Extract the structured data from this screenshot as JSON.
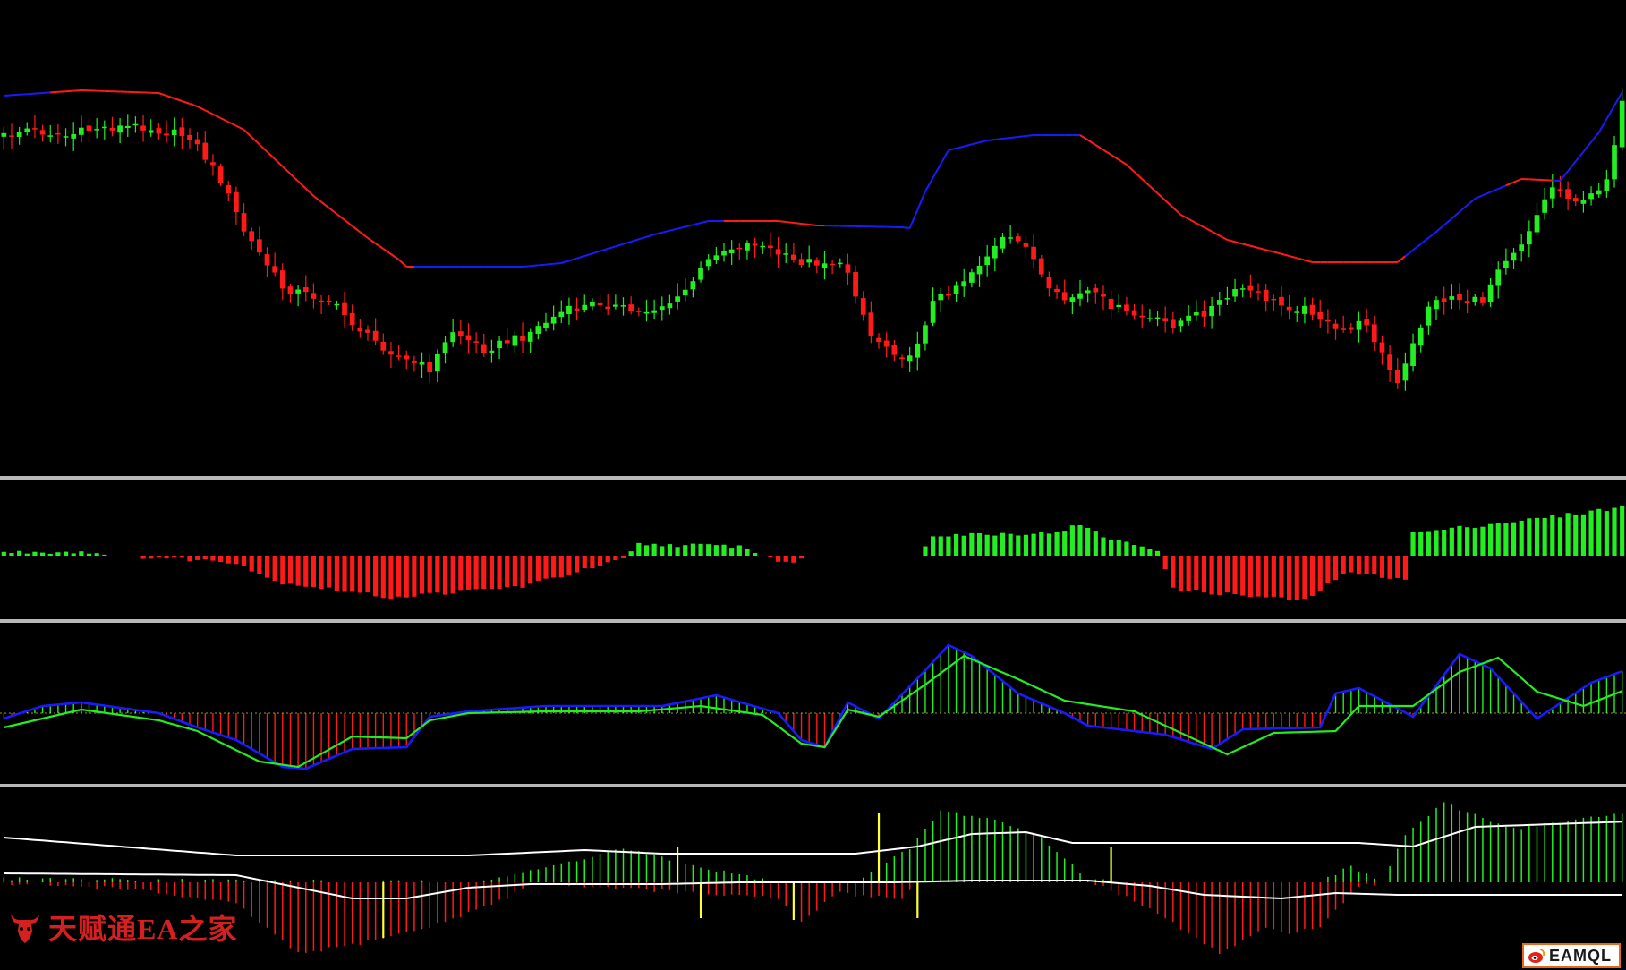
{
  "colors": {
    "background": "#000000",
    "bull": "#22ee22",
    "bear": "#ff1a1a",
    "ma_up": "#1a1aff",
    "ma_down": "#ff1a1a",
    "separator": "#b8b8b8",
    "signal": "#ffff33",
    "white_line": "#ffffff"
  },
  "watermark": {
    "text": "天赋通EA之家",
    "icon": "bull-head-icon"
  },
  "brand_logo": {
    "text": "EAMQL",
    "icon": "weibo-icon"
  },
  "chart_data": [
    {
      "type": "candlestick",
      "panel": "price",
      "n_bars": 210,
      "close_path": [
        [
          0,
          152
        ],
        [
          3,
          144
        ],
        [
          8,
          152
        ],
        [
          12,
          143
        ],
        [
          18,
          141
        ],
        [
          21,
          148
        ],
        [
          24,
          152
        ],
        [
          28,
          200
        ],
        [
          31,
          258
        ],
        [
          36,
          321
        ],
        [
          42,
          336
        ],
        [
          47,
          376
        ],
        [
          52,
          403
        ],
        [
          55,
          412
        ],
        [
          58,
          370
        ],
        [
          62,
          390
        ],
        [
          67,
          376
        ],
        [
          72,
          349
        ],
        [
          77,
          338
        ],
        [
          82,
          350
        ],
        [
          87,
          335
        ],
        [
          92,
          281
        ],
        [
          97,
          271
        ],
        [
          102,
          292
        ],
        [
          107,
          293
        ],
        [
          109,
          303
        ],
        [
          112,
          375
        ],
        [
          115,
          392
        ],
        [
          117,
          402
        ],
        [
          120,
          338
        ],
        [
          124,
          312
        ],
        [
          129,
          268
        ],
        [
          132,
          272
        ],
        [
          135,
          327
        ],
        [
          137,
          335
        ],
        [
          140,
          326
        ],
        [
          145,
          350
        ],
        [
          148,
          357
        ],
        [
          151,
          362
        ],
        [
          155,
          349
        ],
        [
          160,
          322
        ],
        [
          165,
          341
        ],
        [
          169,
          347
        ],
        [
          172,
          371
        ],
        [
          176,
          360
        ],
        [
          180,
          431
        ],
        [
          184,
          341
        ],
        [
          187,
          331
        ],
        [
          189,
          337
        ],
        [
          191,
          336
        ],
        [
          193,
          297
        ],
        [
          196,
          271
        ],
        [
          200,
          208
        ],
        [
          204,
          228
        ],
        [
          207,
          199
        ],
        [
          210,
          76
        ]
      ],
      "ma_path": [
        [
          0,
          107
        ],
        [
          10,
          101
        ],
        [
          20,
          104
        ],
        [
          25,
          119
        ],
        [
          31,
          145
        ],
        [
          40,
          219
        ],
        [
          47,
          266
        ],
        [
          51,
          290
        ],
        [
          52,
          298
        ],
        [
          67,
          298
        ],
        [
          72,
          294
        ],
        [
          84,
          262
        ],
        [
          91,
          247
        ],
        [
          100,
          247
        ],
        [
          105,
          252
        ],
        [
          116,
          254
        ],
        [
          117,
          255
        ],
        [
          119,
          214
        ],
        [
          122,
          168
        ],
        [
          127,
          157
        ],
        [
          133,
          151
        ],
        [
          139,
          151
        ],
        [
          145,
          184
        ],
        [
          152,
          240
        ],
        [
          158,
          268
        ],
        [
          166,
          286
        ],
        [
          169,
          293
        ],
        [
          180,
          293
        ],
        [
          185,
          259
        ],
        [
          190,
          222
        ],
        [
          196,
          200
        ],
        [
          201,
          202
        ],
        [
          206,
          148
        ],
        [
          210,
          88
        ]
      ],
      "ma_down_segments": [
        [
          6,
          26
        ],
        [
          26,
          53
        ],
        [
          93,
          106
        ],
        [
          139,
          181
        ],
        [
          194,
          200
        ]
      ]
    },
    {
      "type": "histogram",
      "panel": "indicator-1",
      "zero_level": 0,
      "values_path": [
        [
          0,
          4
        ],
        [
          10,
          5
        ],
        [
          15,
          0
        ],
        [
          30,
          -8
        ],
        [
          35,
          -32
        ],
        [
          50,
          -52
        ],
        [
          67,
          -38
        ],
        [
          80,
          -5
        ],
        [
          82,
          14
        ],
        [
          95,
          12
        ],
        [
          101,
          -10
        ],
        [
          104,
          0
        ],
        [
          112,
          0
        ],
        [
          118,
          0
        ],
        [
          120,
          26
        ],
        [
          135,
          28
        ],
        [
          139,
          38
        ],
        [
          143,
          20
        ],
        [
          149,
          8
        ],
        [
          151,
          -42
        ],
        [
          168,
          -56
        ],
        [
          173,
          -22
        ],
        [
          181,
          -28
        ],
        [
          182,
          28
        ],
        [
          200,
          48
        ],
        [
          210,
          62
        ]
      ]
    },
    {
      "type": "line+histogram",
      "panel": "indicator-2",
      "series": [
        {
          "name": "",
          "color": "blue",
          "path": [
            [
              0,
              -6
            ],
            [
              5,
              8
            ],
            [
              10,
              12
            ],
            [
              20,
              0
            ],
            [
              25,
              -16
            ],
            [
              30,
              -30
            ],
            [
              36,
              -60
            ],
            [
              39,
              -62
            ],
            [
              45,
              -40
            ],
            [
              52,
              -38
            ],
            [
              55,
              -4
            ],
            [
              60,
              2
            ],
            [
              70,
              8
            ],
            [
              85,
              8
            ],
            [
              92,
              20
            ],
            [
              100,
              0
            ],
            [
              103,
              -30
            ],
            [
              106,
              -38
            ],
            [
              109,
              12
            ],
            [
              113,
              -6
            ],
            [
              119,
              48
            ],
            [
              122,
              76
            ],
            [
              125,
              64
            ],
            [
              131,
              22
            ],
            [
              137,
              0
            ],
            [
              140,
              -14
            ],
            [
              150,
              -24
            ],
            [
              156,
              -40
            ],
            [
              160,
              -18
            ],
            [
              170,
              -16
            ],
            [
              172,
              22
            ],
            [
              175,
              28
            ],
            [
              182,
              -4
            ],
            [
              188,
              66
            ],
            [
              192,
              50
            ],
            [
              198,
              -6
            ],
            [
              205,
              34
            ],
            [
              210,
              50
            ]
          ]
        },
        {
          "name": "",
          "color": "green",
          "path": [
            [
              0,
              -16
            ],
            [
              10,
              4
            ],
            [
              20,
              -8
            ],
            [
              25,
              -20
            ],
            [
              33,
              -54
            ],
            [
              38,
              -60
            ],
            [
              45,
              -26
            ],
            [
              52,
              -28
            ],
            [
              55,
              -8
            ],
            [
              60,
              0
            ],
            [
              70,
              2
            ],
            [
              82,
              2
            ],
            [
              90,
              8
            ],
            [
              98,
              -2
            ],
            [
              103,
              -34
            ],
            [
              106,
              -38
            ],
            [
              109,
              4
            ],
            [
              113,
              -4
            ],
            [
              119,
              32
            ],
            [
              124,
              64
            ],
            [
              131,
              38
            ],
            [
              137,
              14
            ],
            [
              146,
              2
            ],
            [
              150,
              -14
            ],
            [
              158,
              -46
            ],
            [
              164,
              -22
            ],
            [
              172,
              -20
            ],
            [
              175,
              8
            ],
            [
              182,
              8
            ],
            [
              188,
              46
            ],
            [
              193,
              62
            ],
            [
              198,
              24
            ],
            [
              204,
              8
            ],
            [
              210,
              28
            ]
          ]
        }
      ]
    },
    {
      "type": "line+histogram",
      "panel": "indicator-3",
      "series": [
        {
          "name": "",
          "color": "white",
          "path": [
            [
              0,
              28
            ],
            [
              30,
              8
            ],
            [
              60,
              8
            ],
            [
              75,
              14
            ],
            [
              85,
              10
            ],
            [
              100,
              10
            ],
            [
              110,
              10
            ],
            [
              118,
              18
            ],
            [
              125,
              32
            ],
            [
              132,
              34
            ],
            [
              138,
              22
            ],
            [
              155,
              22
            ],
            [
              175,
              22
            ],
            [
              182,
              18
            ],
            [
              190,
              40
            ],
            [
              210,
              46
            ]
          ]
        },
        {
          "name": "",
          "color": "white",
          "path": [
            [
              0,
              -12
            ],
            [
              30,
              -14
            ],
            [
              45,
              -40
            ],
            [
              52,
              -40
            ],
            [
              60,
              -28
            ],
            [
              68,
              -24
            ],
            [
              85,
              -24
            ],
            [
              95,
              -22
            ],
            [
              115,
              -22
            ],
            [
              125,
              -20
            ],
            [
              140,
              -20
            ],
            [
              148,
              -26
            ],
            [
              155,
              -36
            ],
            [
              165,
              -40
            ],
            [
              172,
              -34
            ],
            [
              180,
              -36
            ],
            [
              210,
              -36
            ]
          ]
        }
      ]
    }
  ]
}
